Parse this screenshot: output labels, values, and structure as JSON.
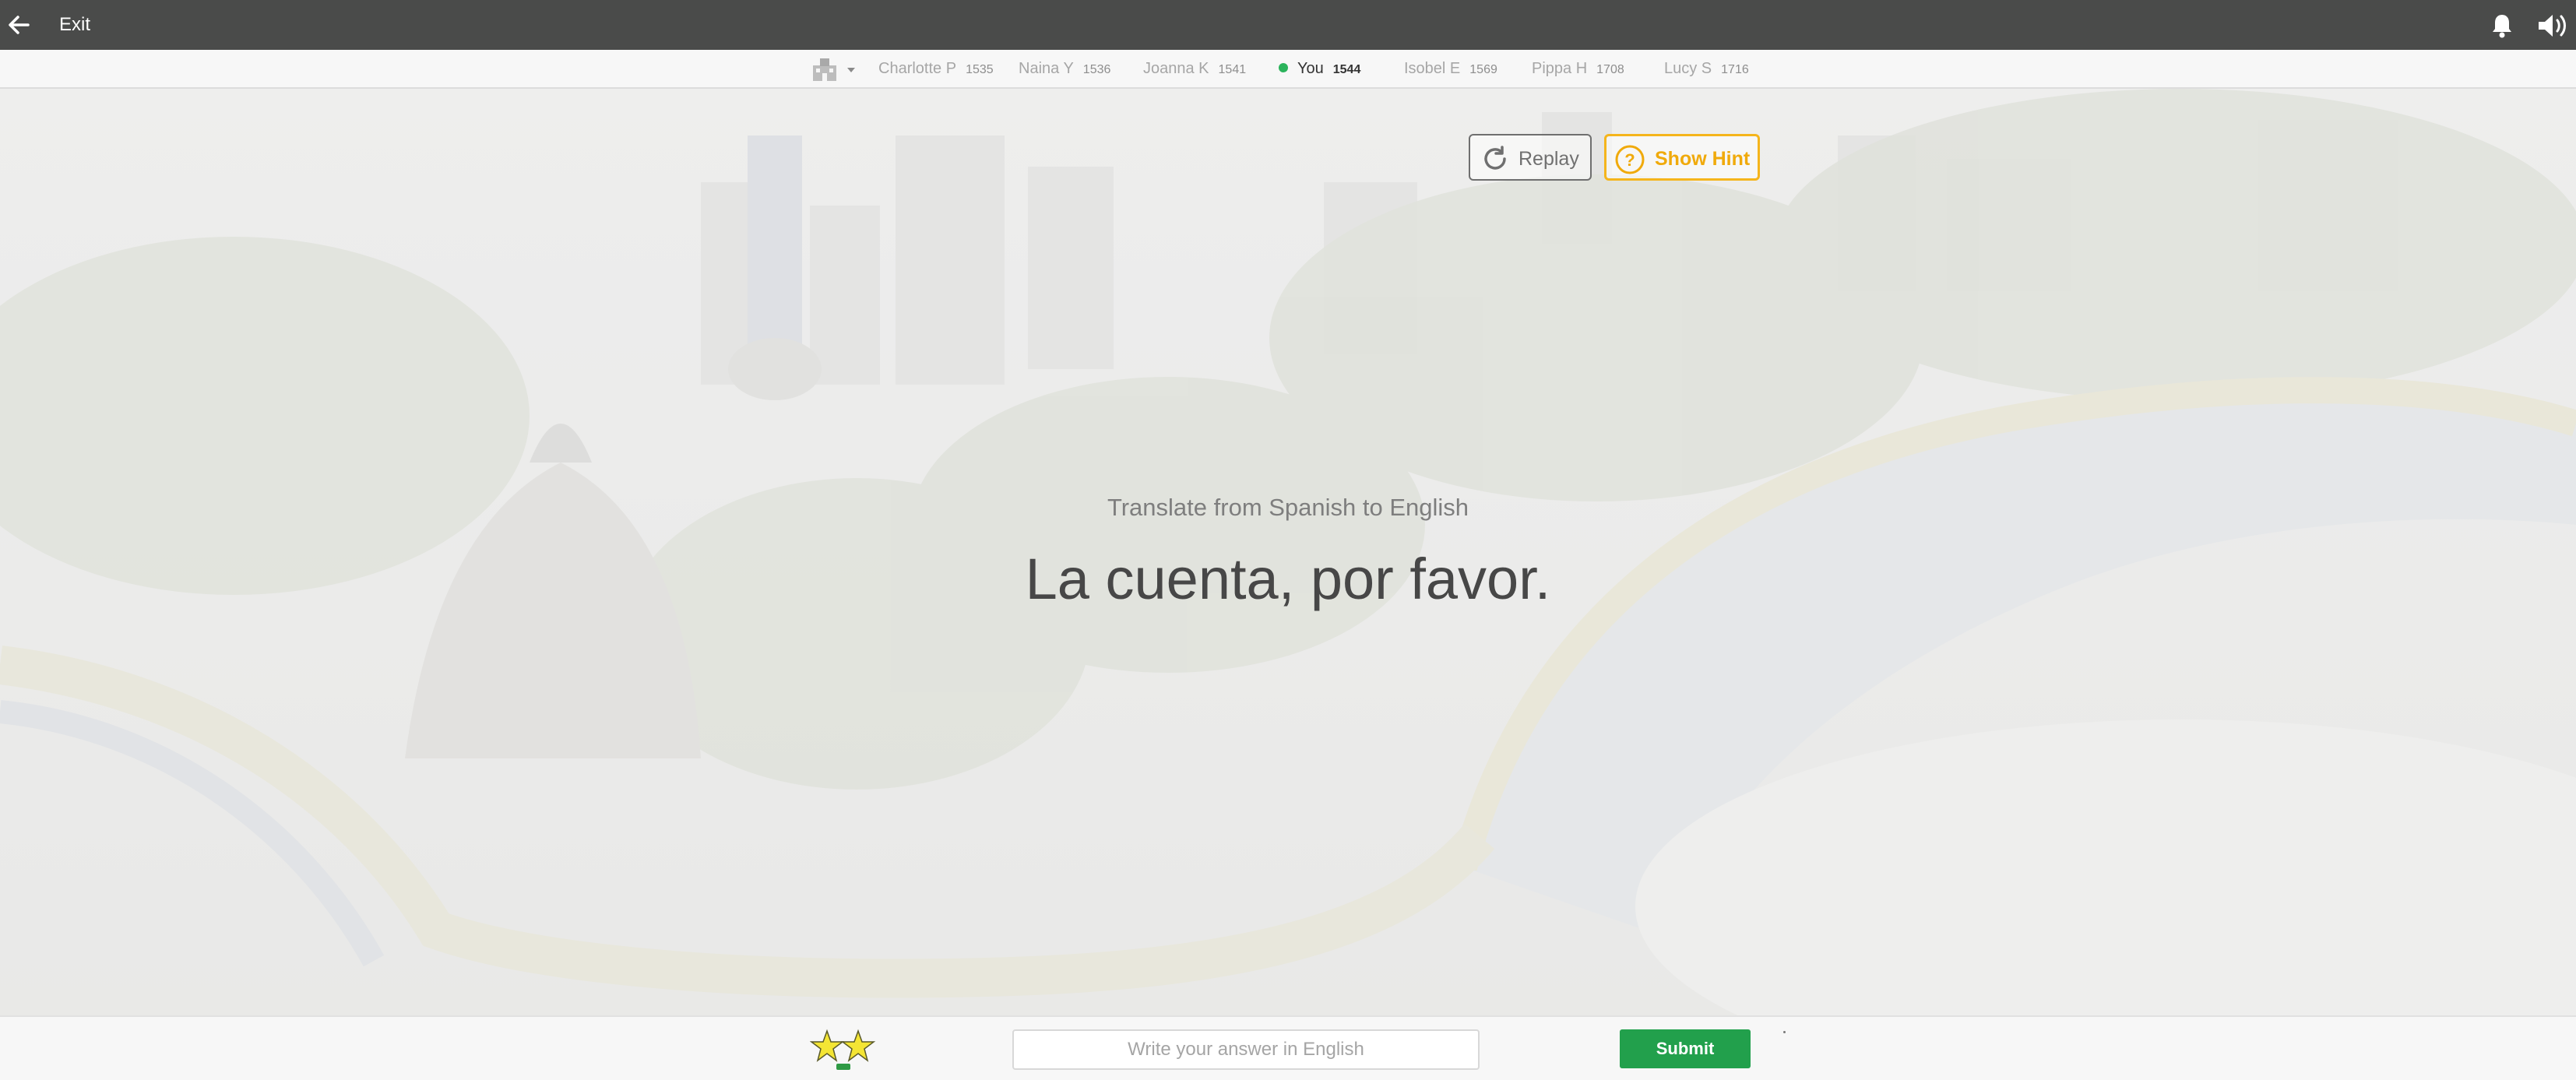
{
  "topbar": {
    "exit_label": "Exit",
    "icons": {
      "back": "back-arrow-icon",
      "notifications": "bell-icon",
      "sound": "speaker-icon"
    }
  },
  "leaderboard": {
    "school_icon": "school-building-icon",
    "players": [
      {
        "name": "Charlotte P",
        "score": "1535",
        "is_you": false
      },
      {
        "name": "Naina Y",
        "score": "1536",
        "is_you": false
      },
      {
        "name": "Joanna K",
        "score": "1541",
        "is_you": false
      },
      {
        "name": "You",
        "score": "1544",
        "is_you": true
      },
      {
        "name": "Isobel E",
        "score": "1569",
        "is_you": false
      },
      {
        "name": "Pippa H",
        "score": "1708",
        "is_you": false
      },
      {
        "name": "Lucy S",
        "score": "1716",
        "is_you": false
      }
    ]
  },
  "main": {
    "replay_label": "Replay",
    "hint_label": "Show Hint",
    "instruction": "Translate from Spanish to English",
    "prompt": "La cuenta, por favor."
  },
  "answer": {
    "placeholder": "Write your answer in English",
    "value": "",
    "submit_label": "Submit",
    "stars_icon": "two-stars-icon"
  },
  "colors": {
    "topbar": "#4a4b4a",
    "submit": "#22a04c",
    "hint_accent": "#f5b51c",
    "you_indicator": "#2bb35b"
  }
}
